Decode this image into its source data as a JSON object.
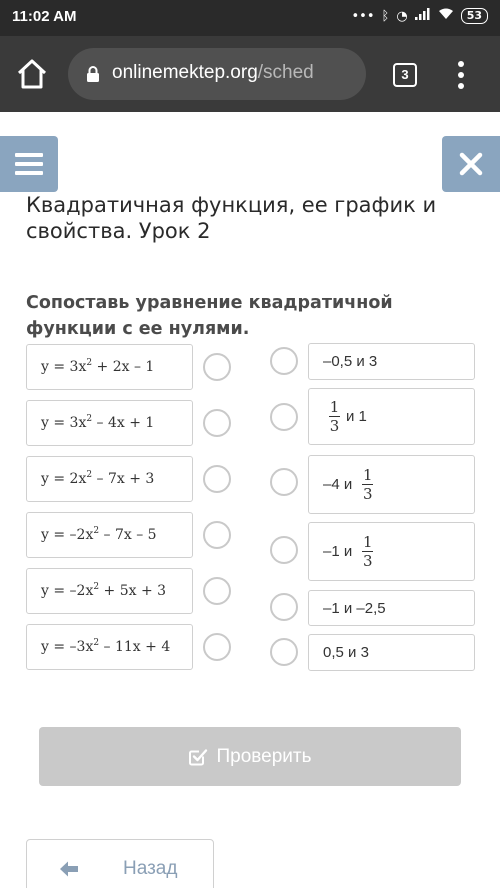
{
  "status_bar": {
    "time": "11:02 AM",
    "battery": "53"
  },
  "browser": {
    "url_host": "onlinemektep.org",
    "url_path": "/sched",
    "tab_count": "3"
  },
  "lesson": {
    "title": "Квадратичная функция, ее график и свойства. Урок 2",
    "task": "Сопоставь уравнение квадратичной функции с ее нулями."
  },
  "equations": [
    {
      "pre": "y = 3x",
      "post": " + 2x – 1"
    },
    {
      "pre": "y = 3x",
      "post": " – 4x + 1"
    },
    {
      "pre": "y = 2x",
      "post": " – 7x + 3"
    },
    {
      "pre": "y = –2x",
      "post": " – 7x – 5"
    },
    {
      "pre": "y = –2x",
      "post": " + 5x + 3"
    },
    {
      "pre": "y = –3x",
      "post": " – 11x + 4"
    }
  ],
  "exponent": "2",
  "answers": [
    {
      "text": "–0,5 и 3"
    },
    {
      "prefix": "",
      "frac_num": "1",
      "frac_den": "3",
      "suffix": "и 1"
    },
    {
      "prefix": "–4 и",
      "frac_num": "1",
      "frac_den": "3",
      "suffix": ""
    },
    {
      "prefix": "–1 и",
      "frac_num": "1",
      "frac_den": "3",
      "suffix": ""
    },
    {
      "text": "–1 и –2,5"
    },
    {
      "text": "0,5 и 3"
    }
  ],
  "buttons": {
    "check": "Проверить",
    "back": "Назад"
  },
  "colors": {
    "accent": "#8aa5bf",
    "disabled_button": "#c9c9c9",
    "status_bar": "#2a2a2a",
    "browser_bar": "#3a3a3a"
  }
}
